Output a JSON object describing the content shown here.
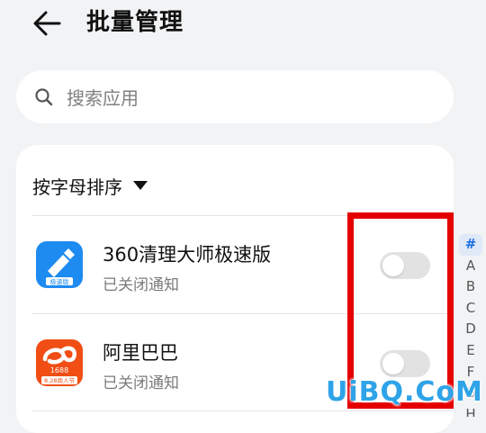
{
  "header": {
    "title": "批量管理"
  },
  "search": {
    "placeholder": "搜索应用"
  },
  "sort": {
    "label": "按字母排序"
  },
  "apps": [
    {
      "name": "360清理大师极速版",
      "status": "已关闭通知",
      "icon": "360-cleaner-icon",
      "icon_label": "极速版",
      "notifications_on": false
    },
    {
      "name": "阿里巴巴",
      "status": "已关闭通知",
      "icon": "alibaba-1688-icon",
      "icon_number": "1688",
      "icon_label": "8.28商人节",
      "notifications_on": false
    }
  ],
  "index": [
    "#",
    "A",
    "B",
    "C",
    "D",
    "E",
    "F",
    "G",
    "H"
  ],
  "colors": {
    "accent": "#1a6fe3",
    "highlight": "#e50000",
    "toggle_off": "#e2e2e2",
    "icon_360": "#1e8bf0",
    "icon_alibaba": "#f04e14"
  },
  "watermark": "UiBQ.CoM"
}
